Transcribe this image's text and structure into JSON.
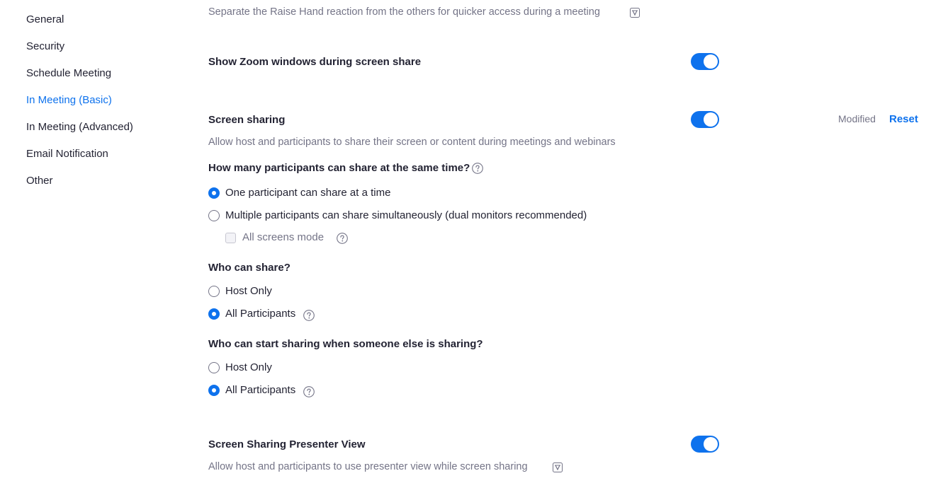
{
  "sidebar": {
    "items": [
      {
        "label": "General"
      },
      {
        "label": "Security"
      },
      {
        "label": "Schedule Meeting"
      },
      {
        "label": "In Meeting (Basic)"
      },
      {
        "label": "In Meeting (Advanced)"
      },
      {
        "label": "Email Notification"
      },
      {
        "label": "Other"
      }
    ],
    "active": "In Meeting (Basic)"
  },
  "settings": {
    "raise_hand": {
      "description": "Separate the Raise Hand reaction from the others for quicker access during a meeting"
    },
    "show_zoom_windows": {
      "title": "Show Zoom windows during screen share",
      "enabled": true
    },
    "screen_sharing": {
      "title": "Screen sharing",
      "enabled": true,
      "status": "Modified",
      "reset_label": "Reset",
      "description": "Allow host and participants to share their screen or content during meetings and webinars",
      "q1": {
        "label": "How many participants can share at the same time?",
        "options": [
          {
            "label": "One participant can share at a time",
            "checked": true
          },
          {
            "label": "Multiple participants can share simultaneously (dual monitors recommended)",
            "checked": false
          }
        ],
        "sub_option": {
          "label": "All screens mode",
          "checked": false,
          "disabled": true
        }
      },
      "q2": {
        "label": "Who can share?",
        "options": [
          {
            "label": "Host Only",
            "checked": false
          },
          {
            "label": "All Participants",
            "checked": true
          }
        ]
      },
      "q3": {
        "label": "Who can start sharing when someone else is sharing?",
        "options": [
          {
            "label": "Host Only",
            "checked": false
          },
          {
            "label": "All Participants",
            "checked": true
          }
        ]
      }
    },
    "presenter_view": {
      "title": "Screen Sharing Presenter View",
      "enabled": true,
      "description": "Allow host and participants to use presenter view while screen sharing"
    }
  },
  "colors": {
    "accent": "#0e72ed",
    "text": "#232333",
    "muted": "#747487"
  }
}
